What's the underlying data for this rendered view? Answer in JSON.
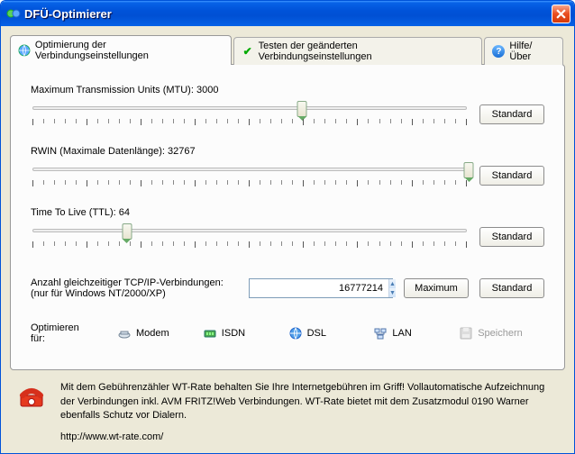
{
  "window": {
    "title": "DFÜ-Optimierer"
  },
  "tabs": {
    "opt": "Optimierung der Verbindungseinstellungen",
    "test": "Testen der geänderten Verbindungseinstellungen",
    "help": "Hilfe/Über"
  },
  "sliders": {
    "mtu": {
      "label": "Maximum Transmission Units (MTU): 3000",
      "percent": 62
    },
    "rwin": {
      "label": "RWIN (Maximale Datenlänge): 32767",
      "percent": 100
    },
    "ttl": {
      "label": "Time To Live (TTL): 64",
      "percent": 22
    }
  },
  "buttons": {
    "standard": "Standard",
    "maximum": "Maximum",
    "save": "Speichern"
  },
  "tcp": {
    "label1": "Anzahl gleichzeitiger TCP/IP-Verbindungen:",
    "label2": "(nur für Windows NT/2000/XP)",
    "value": "16777214"
  },
  "opt": {
    "lead1": "Optimieren",
    "lead2": "für:",
    "modem": "Modem",
    "isdn": "ISDN",
    "dsl": "DSL",
    "lan": "LAN"
  },
  "footer": {
    "text": "Mit dem Gebührenzähler WT-Rate behalten Sie Ihre Internetgebühren im Griff! Vollautomatische Aufzeichnung der Verbindungen inkl. AVM FRITZ!Web Verbindungen. WT-Rate bietet mit dem Zusatzmodul 0190 Warner ebenfalls Schutz vor Dialern.",
    "link": "http://www.wt-rate.com/"
  }
}
